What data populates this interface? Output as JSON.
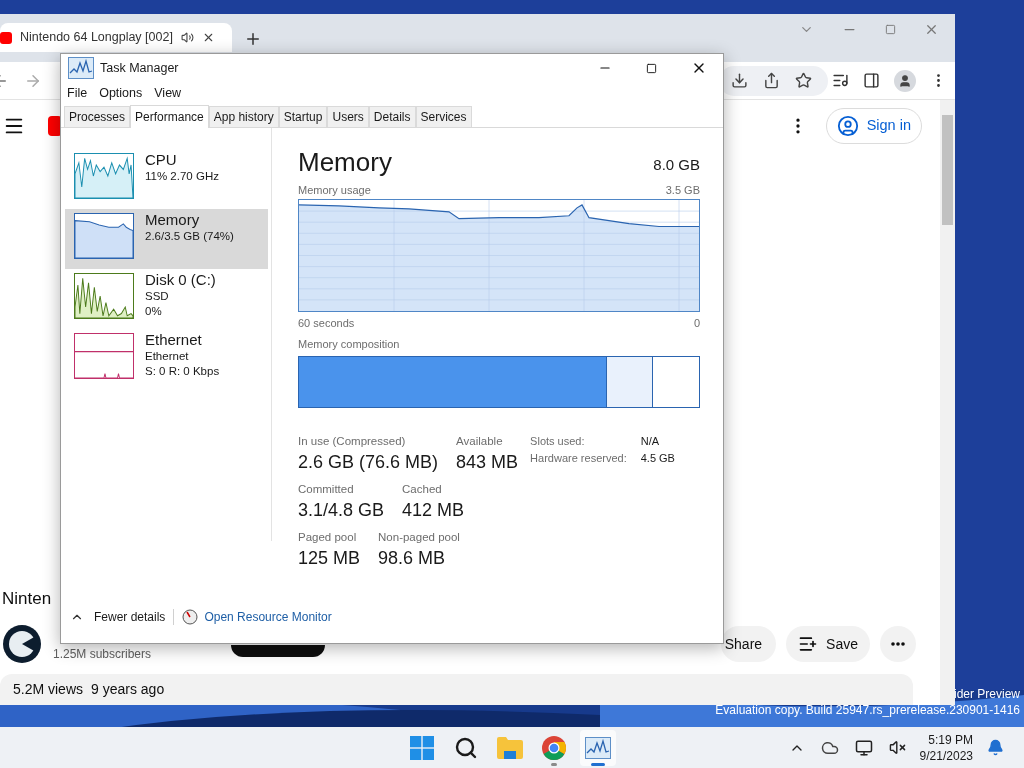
{
  "browser": {
    "tabs": [
      {
        "title": "Nintendo 64 Longplay [002]",
        "selected": true
      }
    ],
    "youtube": {
      "sign_in": "Sign in",
      "video_title": "Ninten",
      "subscribers": "1.25M subscribers",
      "actions": [
        {
          "kind": "share",
          "label": "Share"
        },
        {
          "kind": "save",
          "label": "Save"
        }
      ],
      "views": "5.2M views",
      "age": "9 years ago"
    }
  },
  "desktop": {
    "notice": [
      "ider Preview",
      "Evaluation copy. Build 25947.rs_prerelease.230901-1416"
    ]
  },
  "task_manager": {
    "title": "Task Manager",
    "menu": [
      "File",
      "Options",
      "View"
    ],
    "tabs": [
      {
        "label": "Processes",
        "selected": false
      },
      {
        "label": "Performance",
        "selected": true
      },
      {
        "label": "App history",
        "selected": false
      },
      {
        "label": "Startup",
        "selected": false
      },
      {
        "label": "Users",
        "selected": false
      },
      {
        "label": "Details",
        "selected": false
      },
      {
        "label": "Services",
        "selected": false
      }
    ],
    "resources": [
      {
        "kind": "cpu",
        "name": "CPU",
        "lines": [
          "11% 2.70 GHz"
        ],
        "selected": false
      },
      {
        "kind": "memory",
        "name": "Memory",
        "lines": [
          "2.6/3.5 GB (74%)"
        ],
        "selected": true
      },
      {
        "kind": "disk",
        "name": "Disk 0 (C:)",
        "lines": [
          "SSD",
          "0%"
        ],
        "selected": false
      },
      {
        "kind": "network",
        "name": "Ethernet",
        "lines": [
          "Ethernet",
          "S: 0 R: 0 Kbps"
        ],
        "selected": false
      }
    ],
    "detail": {
      "heading": "Memory",
      "total": "8.0 GB",
      "usage_label": "Memory usage",
      "usage_max": "3.5 GB",
      "time_span": "60 seconds",
      "time_end": "0",
      "composition_label": "Memory composition",
      "composition": [
        {
          "kind": "in_use",
          "level": 0.77
        },
        {
          "kind": "standby",
          "level": 0.885
        }
      ],
      "stat_rows": [
        [
          {
            "label": "In use (Compressed)",
            "value": "2.6 GB (76.6 MB)"
          },
          {
            "label": "Available",
            "value": "843 MB"
          }
        ],
        [
          {
            "label": "Committed",
            "value": "3.1/4.8 GB"
          },
          {
            "label": "Cached",
            "value": "412 MB"
          }
        ],
        [
          {
            "label": "Paged pool",
            "value": "125 MB"
          },
          {
            "label": "Non-paged pool",
            "value": "98.6 MB"
          }
        ]
      ],
      "properties": [
        {
          "label": "Slots used:",
          "value": "N/A"
        },
        {
          "label": "Hardware reserved:",
          "value": "4.5 GB"
        }
      ]
    },
    "fewer_details": "Fewer details",
    "resource_monitor": "Open Resource Monitor"
  },
  "taskbar": {
    "apps": [
      {
        "kind": "start",
        "running": false,
        "selected": false
      },
      {
        "kind": "search",
        "running": false,
        "selected": false
      },
      {
        "kind": "explorer",
        "running": false,
        "selected": false
      },
      {
        "kind": "chrome",
        "running": true,
        "selected": false
      },
      {
        "kind": "taskmanager",
        "running": true,
        "selected": true
      }
    ],
    "time": "5:19 PM",
    "date": "9/21/2023"
  }
}
